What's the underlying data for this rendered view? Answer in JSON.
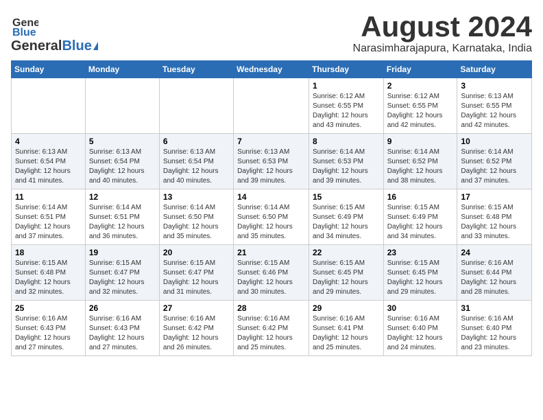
{
  "header": {
    "logo_general": "General",
    "logo_blue": "Blue",
    "month_title": "August 2024",
    "location": "Narasimharajapura, Karnataka, India"
  },
  "days_of_week": [
    "Sunday",
    "Monday",
    "Tuesday",
    "Wednesday",
    "Thursday",
    "Friday",
    "Saturday"
  ],
  "weeks": [
    [
      {
        "day": "",
        "info": ""
      },
      {
        "day": "",
        "info": ""
      },
      {
        "day": "",
        "info": ""
      },
      {
        "day": "",
        "info": ""
      },
      {
        "day": "1",
        "info": "Sunrise: 6:12 AM\nSunset: 6:55 PM\nDaylight: 12 hours and 43 minutes."
      },
      {
        "day": "2",
        "info": "Sunrise: 6:12 AM\nSunset: 6:55 PM\nDaylight: 12 hours and 42 minutes."
      },
      {
        "day": "3",
        "info": "Sunrise: 6:13 AM\nSunset: 6:55 PM\nDaylight: 12 hours and 42 minutes."
      }
    ],
    [
      {
        "day": "4",
        "info": "Sunrise: 6:13 AM\nSunset: 6:54 PM\nDaylight: 12 hours and 41 minutes."
      },
      {
        "day": "5",
        "info": "Sunrise: 6:13 AM\nSunset: 6:54 PM\nDaylight: 12 hours and 40 minutes."
      },
      {
        "day": "6",
        "info": "Sunrise: 6:13 AM\nSunset: 6:54 PM\nDaylight: 12 hours and 40 minutes."
      },
      {
        "day": "7",
        "info": "Sunrise: 6:13 AM\nSunset: 6:53 PM\nDaylight: 12 hours and 39 minutes."
      },
      {
        "day": "8",
        "info": "Sunrise: 6:14 AM\nSunset: 6:53 PM\nDaylight: 12 hours and 39 minutes."
      },
      {
        "day": "9",
        "info": "Sunrise: 6:14 AM\nSunset: 6:52 PM\nDaylight: 12 hours and 38 minutes."
      },
      {
        "day": "10",
        "info": "Sunrise: 6:14 AM\nSunset: 6:52 PM\nDaylight: 12 hours and 37 minutes."
      }
    ],
    [
      {
        "day": "11",
        "info": "Sunrise: 6:14 AM\nSunset: 6:51 PM\nDaylight: 12 hours and 37 minutes."
      },
      {
        "day": "12",
        "info": "Sunrise: 6:14 AM\nSunset: 6:51 PM\nDaylight: 12 hours and 36 minutes."
      },
      {
        "day": "13",
        "info": "Sunrise: 6:14 AM\nSunset: 6:50 PM\nDaylight: 12 hours and 35 minutes."
      },
      {
        "day": "14",
        "info": "Sunrise: 6:14 AM\nSunset: 6:50 PM\nDaylight: 12 hours and 35 minutes."
      },
      {
        "day": "15",
        "info": "Sunrise: 6:15 AM\nSunset: 6:49 PM\nDaylight: 12 hours and 34 minutes."
      },
      {
        "day": "16",
        "info": "Sunrise: 6:15 AM\nSunset: 6:49 PM\nDaylight: 12 hours and 34 minutes."
      },
      {
        "day": "17",
        "info": "Sunrise: 6:15 AM\nSunset: 6:48 PM\nDaylight: 12 hours and 33 minutes."
      }
    ],
    [
      {
        "day": "18",
        "info": "Sunrise: 6:15 AM\nSunset: 6:48 PM\nDaylight: 12 hours and 32 minutes."
      },
      {
        "day": "19",
        "info": "Sunrise: 6:15 AM\nSunset: 6:47 PM\nDaylight: 12 hours and 32 minutes."
      },
      {
        "day": "20",
        "info": "Sunrise: 6:15 AM\nSunset: 6:47 PM\nDaylight: 12 hours and 31 minutes."
      },
      {
        "day": "21",
        "info": "Sunrise: 6:15 AM\nSunset: 6:46 PM\nDaylight: 12 hours and 30 minutes."
      },
      {
        "day": "22",
        "info": "Sunrise: 6:15 AM\nSunset: 6:45 PM\nDaylight: 12 hours and 29 minutes."
      },
      {
        "day": "23",
        "info": "Sunrise: 6:15 AM\nSunset: 6:45 PM\nDaylight: 12 hours and 29 minutes."
      },
      {
        "day": "24",
        "info": "Sunrise: 6:16 AM\nSunset: 6:44 PM\nDaylight: 12 hours and 28 minutes."
      }
    ],
    [
      {
        "day": "25",
        "info": "Sunrise: 6:16 AM\nSunset: 6:43 PM\nDaylight: 12 hours and 27 minutes."
      },
      {
        "day": "26",
        "info": "Sunrise: 6:16 AM\nSunset: 6:43 PM\nDaylight: 12 hours and 27 minutes."
      },
      {
        "day": "27",
        "info": "Sunrise: 6:16 AM\nSunset: 6:42 PM\nDaylight: 12 hours and 26 minutes."
      },
      {
        "day": "28",
        "info": "Sunrise: 6:16 AM\nSunset: 6:42 PM\nDaylight: 12 hours and 25 minutes."
      },
      {
        "day": "29",
        "info": "Sunrise: 6:16 AM\nSunset: 6:41 PM\nDaylight: 12 hours and 25 minutes."
      },
      {
        "day": "30",
        "info": "Sunrise: 6:16 AM\nSunset: 6:40 PM\nDaylight: 12 hours and 24 minutes."
      },
      {
        "day": "31",
        "info": "Sunrise: 6:16 AM\nSunset: 6:40 PM\nDaylight: 12 hours and 23 minutes."
      }
    ]
  ]
}
